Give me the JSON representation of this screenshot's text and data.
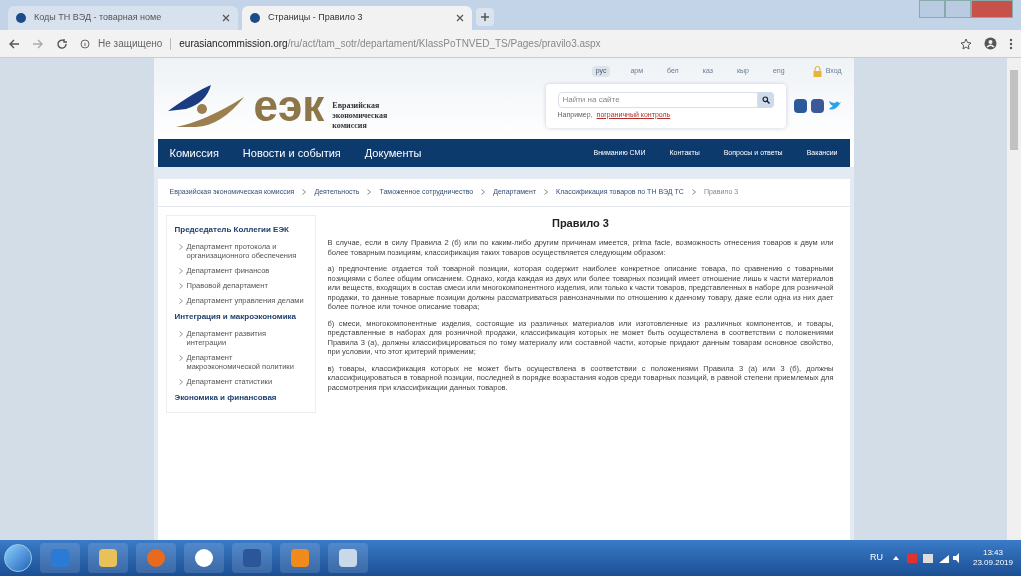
{
  "browser": {
    "tabs": [
      {
        "title": "Коды ТН ВЭД - товарная номе",
        "selected": false
      },
      {
        "title": "Страницы - Правило 3",
        "selected": true
      }
    ],
    "address": {
      "security": "Не защищено",
      "domain": "eurasiancommission.org",
      "path": "/ru/act/tam_sotr/departament/KlassPoTNVED_TS/Pages/pravilo3.aspx"
    }
  },
  "header": {
    "languages": [
      {
        "label": "рус",
        "selected": true
      },
      {
        "label": "арм",
        "selected": false
      },
      {
        "label": "бел",
        "selected": false
      },
      {
        "label": "каз",
        "selected": false
      },
      {
        "label": "кыр",
        "selected": false
      },
      {
        "label": "eng",
        "selected": false
      }
    ],
    "login": "Вход",
    "logo_text": "еэк",
    "logo_caption": "Евразийская экономическая комиссия",
    "search": {
      "placeholder": "Найти на сайте",
      "example_prefix": "Например,",
      "example_link": "пограничный контроль"
    }
  },
  "nav": {
    "main": [
      "Комиссия",
      "Новости и события",
      "Документы"
    ],
    "secondary": [
      "Вниманию СМИ",
      "Контакты",
      "Вопросы и ответы",
      "Вакансии"
    ]
  },
  "breadcrumbs": [
    "Евразийская экономическая комиссия",
    "Деятельность",
    "Таможенное сотрудничество",
    "Департамент",
    "Классификация товаров по ТН ВЭД ТС",
    "Правило 3"
  ],
  "sidebar": [
    {
      "heading": "Председатель Коллегии ЕЭК",
      "items": [
        "Департамент протокола и организационного обеспечения",
        "Департамент финансов",
        "Правовой департамент",
        "Департамент управления делами"
      ]
    },
    {
      "heading": "Интеграция и макроэкономика",
      "items": [
        "Департамент развития интеграции",
        "Департамент макроэкономической политики",
        "Департамент статистики"
      ]
    },
    {
      "heading": "Экономика и финансовая"
    }
  ],
  "article": {
    "title": "Правило 3",
    "paragraphs": [
      "В случае, если в силу Правила 2 (б) или по каким-либо другим причинам имеется, prima facie, возможность отнесения товаров к двум или более товарным позициям, классификация таких товаров осуществляется следующим образом:",
      "а) предпочтение отдается той товарной позиции, которая содержит наиболее конкретное описание товара, по сравнению с товарными позициями с более общим описанием. Однако, когда каждая из двух или более товарных позиций имеет отношение лишь к части материалов или веществ, входящих в состав смеси или многокомпонентного изделия, или только к части товаров, представленных в наборе для розничной продажи, то данные товарные позиции должны рассматриваться равнозначными по отношению к данному товару, даже если одна из них дает более полное или точное описание товара;",
      "б) смеси, многокомпонентные изделия, состоящие из различных материалов или изготовленные из различных компонентов, и товары, представленные в наборах для розничной продажи, классификация которых не может быть осуществлена в соответствии с положениями Правила 3 (а), должны классифицироваться по тому материалу или составной части, которые придают данным товарам основное свойство, при условии, что этот критерий применим;",
      "в) товары, классификация которых не может быть осуществлена в соответствии с положениями Правила 3 (а) или 3 (б), должны классифицироваться в товарной позиции, последней в порядке возрастания кодов среди товарных позиций, в равной степени приемлемых для рассмотрения при классификации данных товаров."
    ]
  },
  "taskbar": {
    "apps": [
      {
        "kind": "ie"
      },
      {
        "kind": "folder"
      },
      {
        "kind": "media"
      },
      {
        "kind": "chrome"
      },
      {
        "kind": "word"
      },
      {
        "kind": "orange"
      },
      {
        "kind": "paint"
      }
    ],
    "language": "RU",
    "time": "13:43",
    "date": "23.09.2019"
  }
}
